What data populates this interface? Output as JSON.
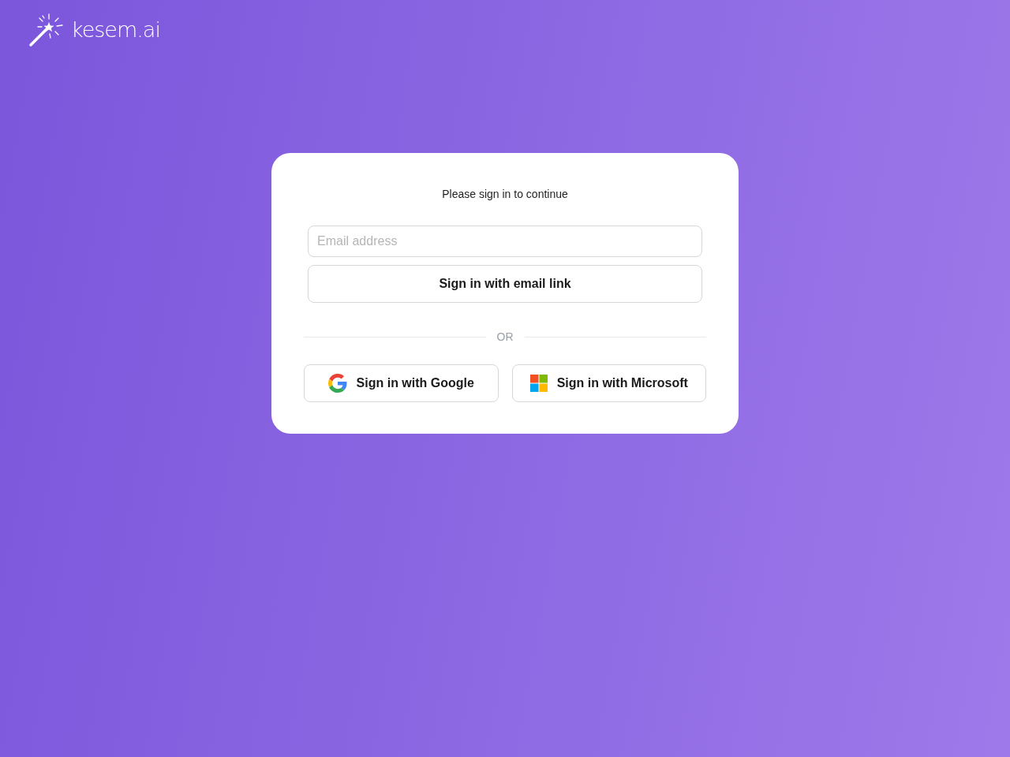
{
  "logo": {
    "text": "kesem.ai"
  },
  "card": {
    "prompt": "Please sign in to continue",
    "email_field": {
      "placeholder": "Email address"
    },
    "email_button": "Sign in with email link",
    "divider": "OR",
    "providers": [
      {
        "kind": "google",
        "label": "Sign in with Google"
      },
      {
        "kind": "microsoft",
        "label": "Sign in with Microsoft"
      }
    ]
  }
}
